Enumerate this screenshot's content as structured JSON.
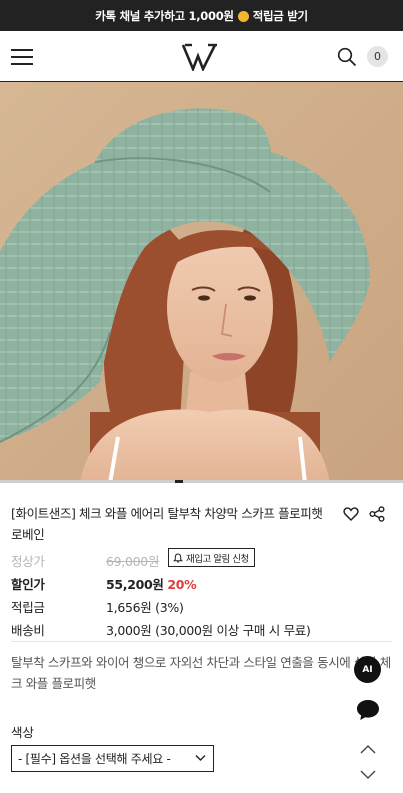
{
  "promo": {
    "text_before": "카톡 채널 추가하고 1,000원",
    "text_after": "적립금 받기",
    "coin_icon": "coin-icon"
  },
  "header": {
    "menu_icon": "hamburger-icon",
    "logo_icon": "brand-logo-icon",
    "search_icon": "search-icon",
    "cart_count": "0"
  },
  "gallery": {
    "image_alt": "초록색 체크 와플 플로피햇을 쓴 모델",
    "slide_count": 4,
    "active_slide": 1
  },
  "product": {
    "title": "[화이트샌즈] 체크 와플 에어리 탈부착 차양막 스카프 플로피햇 로베인",
    "wish_icon": "heart-icon",
    "share_icon": "share-icon",
    "regular_label": "정상가",
    "regular_price": "69,000원",
    "restock_label": "재입고 알림 신청",
    "sale_label": "할인가",
    "sale_price": "55,200원",
    "discount_rate": "20%",
    "points_label": "적립금",
    "points_value": "1,656원 (3%)",
    "shipping_label": "배송비",
    "shipping_value": "3,000원 (30,000원 이상 구매 시 무료)",
    "summary": "탈부착 스카프와 와이어 챙으로 자외선 차단과 스타일 연출을 동시에 살린 체크 와플 플로피햇"
  },
  "options": {
    "label": "색상",
    "select_value": "- [필수] 옵션을 선택해 주세요 -"
  },
  "floating": {
    "ai_label": "AI",
    "chat_icon": "chat-icon",
    "up_icon": "chevron-up-icon",
    "down_icon": "chevron-down-icon"
  },
  "colors": {
    "promo_bg": "#222222",
    "coin": "#f2b632",
    "discount": "#e23c3c",
    "hat": "#8fb3a0",
    "hair": "#9c4f2e"
  }
}
